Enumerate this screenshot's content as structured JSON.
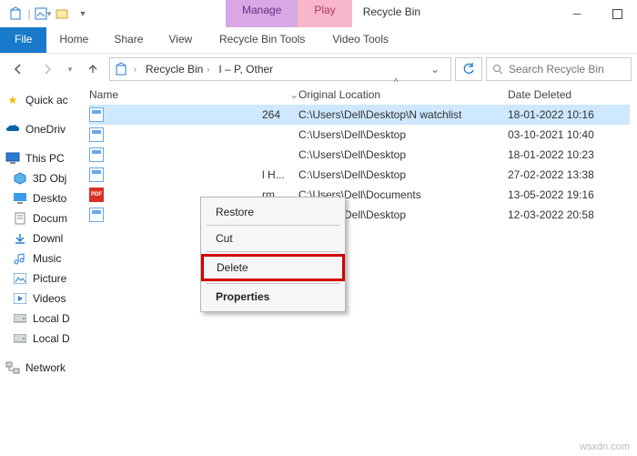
{
  "titlebar": {
    "manage_group": "Manage",
    "play_group": "Play",
    "app_title": "Recycle Bin"
  },
  "ribbon": {
    "file": "File",
    "home": "Home",
    "share": "Share",
    "view": "View",
    "rbt": "Recycle Bin Tools",
    "vt": "Video Tools"
  },
  "breadcrumbs": {
    "b1": "Recycle Bin",
    "b2": "I – P, Other"
  },
  "search": {
    "placeholder": "Search Recycle Bin"
  },
  "sidebar": {
    "quick": "Quick ac",
    "onedrive": "OneDriv",
    "thispc": "This PC",
    "n3d": "3D Obj",
    "desktop": "Deskto",
    "docs": "Docum",
    "downl": "Downl",
    "music": "Music",
    "pics": "Picture",
    "videos": "Videos",
    "loc1": "Local D",
    "loc2": "Local D",
    "net": "Network"
  },
  "columns": {
    "name": "Name",
    "orig": "Original Location",
    "date": "Date Deleted"
  },
  "rows": [
    {
      "name": "264",
      "name_prefix": "                              ",
      "orig": "C:\\Users\\Dell\\Desktop\\N watchlist",
      "date": "18-01-2022 10:16",
      "icon": "file"
    },
    {
      "name": "",
      "orig": "C:\\Users\\Dell\\Desktop",
      "date": "03-10-2021 10:40",
      "icon": "file"
    },
    {
      "name": "",
      "orig": "C:\\Users\\Dell\\Desktop",
      "date": "18-01-2022 10:23",
      "icon": "file"
    },
    {
      "name": "l H...",
      "orig": "C:\\Users\\Dell\\Desktop",
      "date": "27-02-2022 13:38",
      "icon": "file"
    },
    {
      "name": "rm...",
      "orig": "C:\\Users\\Dell\\Documents",
      "date": "13-05-2022 19:16",
      "icon": "pdf"
    },
    {
      "name": "",
      "orig": "C:\\Users\\Dell\\Desktop",
      "date": "12-03-2022 20:58",
      "icon": "file"
    }
  ],
  "context_menu": {
    "restore": "Restore",
    "cut": "Cut",
    "delete": "Delete",
    "props": "Properties"
  },
  "watermark": "wsxdn.com"
}
